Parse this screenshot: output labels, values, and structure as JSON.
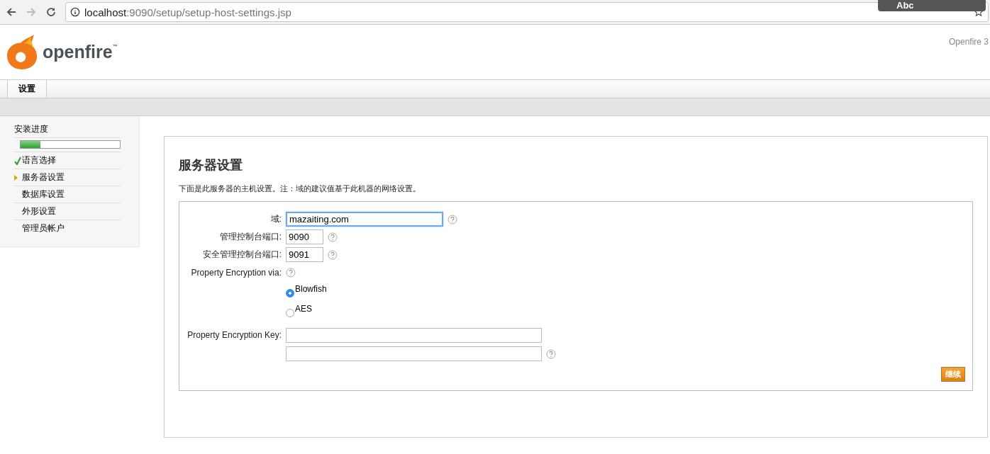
{
  "browser": {
    "url_host": "localhost",
    "url_rest": ":9090/setup/setup-host-settings.jsp",
    "overlay": "Abc"
  },
  "header": {
    "logo": "openfire",
    "tm": "™",
    "version": "Openfire 3"
  },
  "tabs": [
    {
      "label": "设置",
      "selected": true
    }
  ],
  "sidebar": {
    "title": "安装进度",
    "progress": {
      "level": 0.2
    },
    "items": [
      {
        "label": "语言选择",
        "kind": "done"
      },
      {
        "label": "服务器设置",
        "kind": "current"
      },
      {
        "label": "数据库设置",
        "kind": "pending"
      },
      {
        "label": "外形设置",
        "kind": "pending"
      },
      {
        "label": "管理员帐户",
        "kind": "pending"
      }
    ]
  },
  "main": {
    "title": "服务器设置",
    "description": "下面是此服务器的主机设置。注：域的建议值基于此机器的网络设置。",
    "fields": [
      {
        "label": "域:",
        "value": "mazaiting.com",
        "kind": "wide",
        "focused": true
      },
      {
        "label": "管理控制台端口:",
        "value": "9090",
        "kind": "short",
        "focused": false
      },
      {
        "label": "安全管理控制台端口:",
        "value": "9091",
        "kind": "short",
        "focused": false
      }
    ],
    "encryption": {
      "label": "Property Encryption via:",
      "options": [
        {
          "label": "Blowfish",
          "selected": true
        },
        {
          "label": "AES",
          "selected": false
        }
      ]
    },
    "key": {
      "label": "Property Encryption Key:"
    },
    "continue_button": "继续"
  }
}
